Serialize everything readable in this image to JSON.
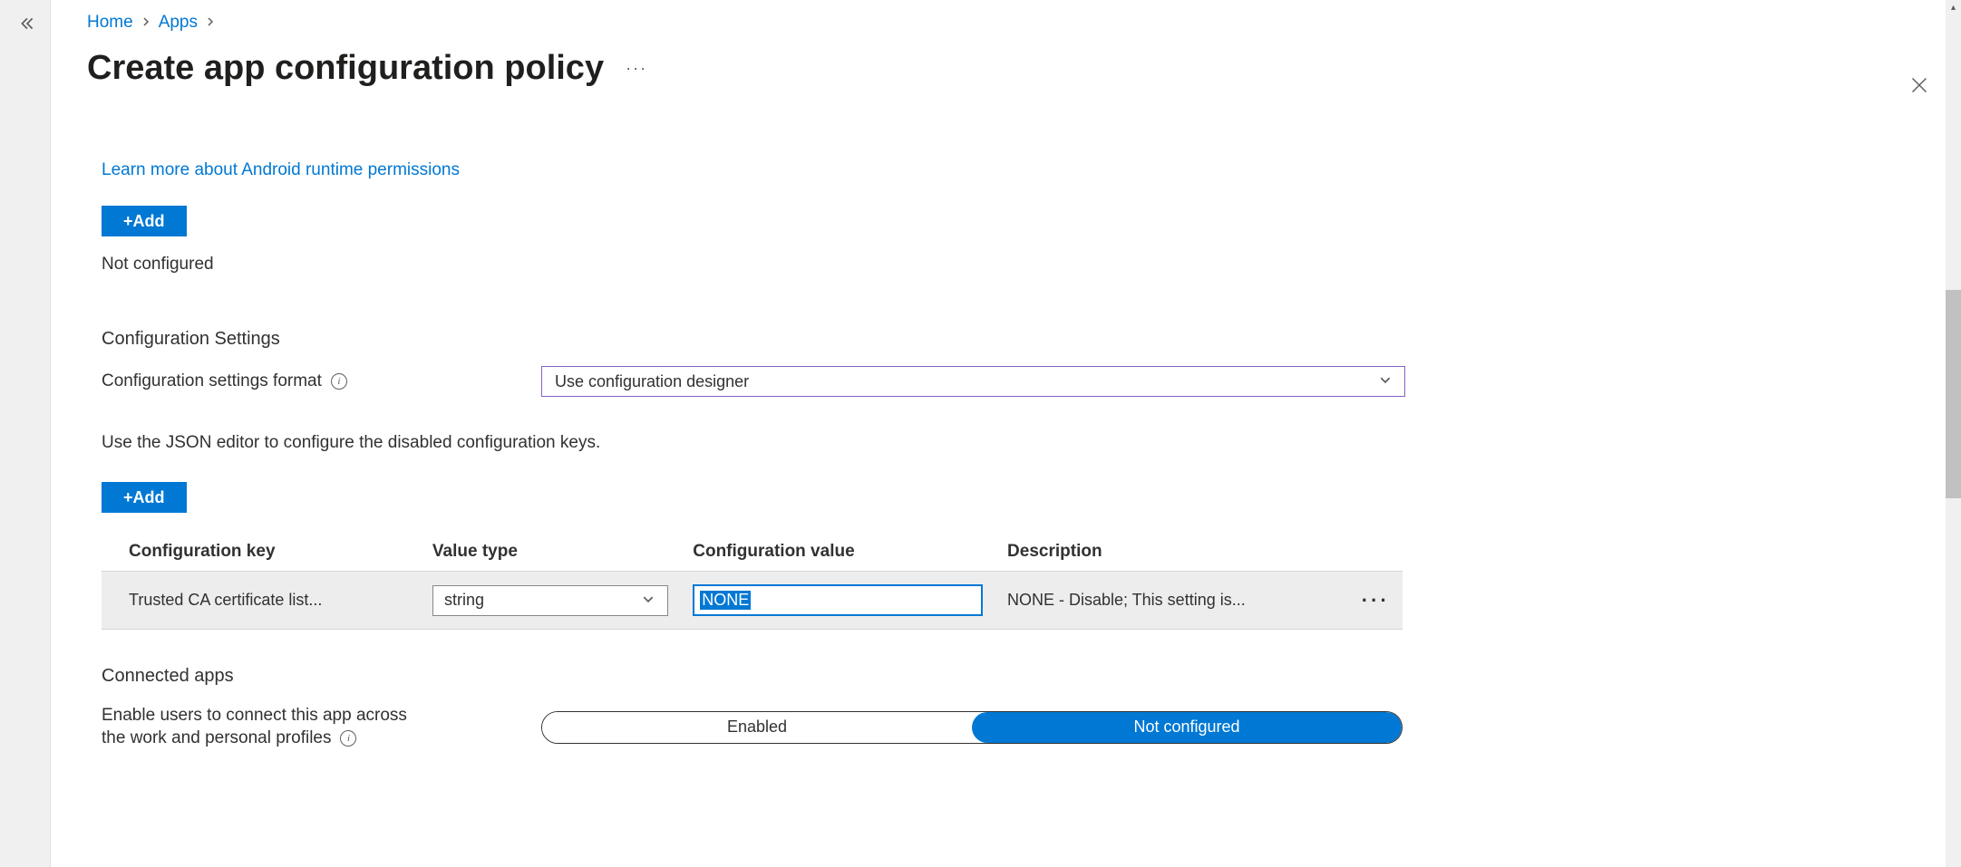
{
  "breadcrumb": {
    "home": "Home",
    "apps": "Apps"
  },
  "page": {
    "title": "Create app configuration policy",
    "more": "···"
  },
  "permissions": {
    "link_text": "Learn more about Android runtime permissions",
    "add_button": "+Add",
    "not_configured": "Not configured"
  },
  "settings": {
    "section_title": "Configuration Settings",
    "format_label": "Configuration settings format",
    "format_value": "Use configuration designer",
    "helper": "Use the JSON editor to configure the disabled configuration keys.",
    "add_button": "+Add",
    "headers": {
      "key": "Configuration key",
      "type": "Value type",
      "value": "Configuration value",
      "desc": "Description"
    },
    "row": {
      "key": "Trusted CA certificate list...",
      "type": "string",
      "value": "NONE",
      "desc": "NONE - Disable; This setting is..."
    }
  },
  "connected": {
    "title": "Connected apps",
    "label": "Enable users to connect this app across the work and personal profiles",
    "label_visible1": "Enable users to connect this app across",
    "label_visible2": "the work and personal profiles",
    "enabled": "Enabled",
    "not_configured": "Not configured"
  }
}
